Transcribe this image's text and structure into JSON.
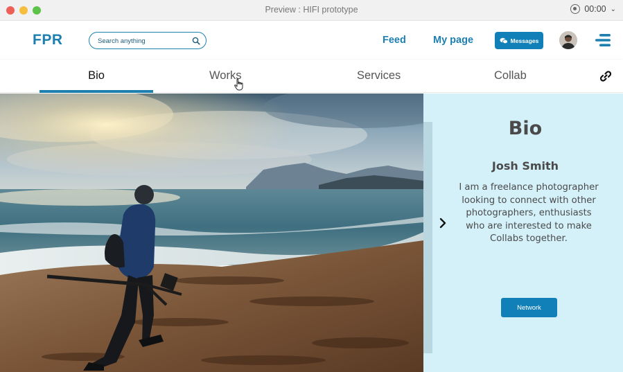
{
  "window": {
    "title": "Preview : HIFI prototype",
    "recording_time": "00:00",
    "controls": [
      "close",
      "minimize",
      "zoom"
    ]
  },
  "header": {
    "logo": "FPR",
    "search": {
      "placeholder": "Search anything",
      "icon": "search-icon"
    },
    "nav": {
      "feed": "Feed",
      "my_page": "My page"
    },
    "messages_button": {
      "label": "Messages",
      "icon": "chat-bubbles-icon"
    },
    "avatar": "avatar",
    "menu_icon": "hamburger-menu-icon"
  },
  "tabs": {
    "items": [
      {
        "label": "Bio",
        "active": true
      },
      {
        "label": "Works",
        "active": false
      },
      {
        "label": "Services",
        "active": false
      },
      {
        "label": "Collab",
        "active": false
      }
    ],
    "share_icon": "link-icon"
  },
  "panel": {
    "heading": "Bio",
    "name": "Josh Smith",
    "description": "I am a freelance photographer looking to connect with other photographers, enthusiasts who are interested to make Collabs together.",
    "button": "Network",
    "next_icon": "chevron-right-icon"
  },
  "colors": {
    "accent": "#1d7fb0",
    "button": "#1280b8",
    "panel_bg": "#d4f1fa",
    "titlebar": "#f1f1f1"
  }
}
